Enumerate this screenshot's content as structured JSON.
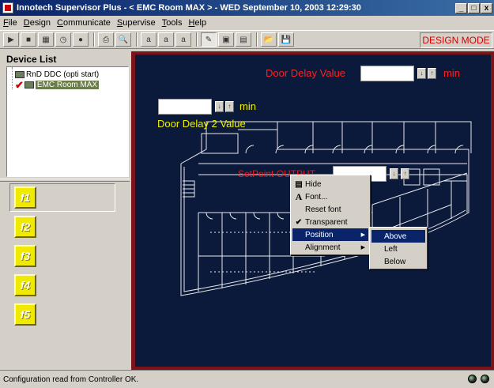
{
  "window": {
    "title": "Innotech Supervisor Plus - < EMC Room MAX > - WED September 10, 2003 12:29:30",
    "minimize_icon": "minimize-icon",
    "maximize_icon": "maximize-icon",
    "close_icon": "close-icon",
    "buttons": [
      "_",
      "□",
      "x"
    ]
  },
  "menu": [
    "File",
    "Design",
    "Communicate",
    "Supervise",
    "Tools",
    "Help"
  ],
  "toolbar": {
    "mode_label": "DESIGN MODE",
    "icons": [
      "play-icon",
      "stop-icon",
      "grid-icon",
      "clock-icon",
      "record-icon",
      "print-icon",
      "preview-icon",
      "text-1-icon",
      "text-2-icon",
      "text-3-icon",
      "design-icon",
      "image-icon",
      "paste-icon",
      "open-icon",
      "save-icon"
    ],
    "glyphs": [
      "▶",
      "■",
      "▦",
      "◷",
      "●",
      "⎙",
      "🔍",
      "a",
      "a",
      "a",
      "✎",
      "▣",
      "▤",
      "📂",
      "💾"
    ]
  },
  "device_list": {
    "title": "Device List",
    "items": [
      {
        "label": "RnD DDC (opti start)",
        "checked": false
      },
      {
        "label": "EMC Room MAX",
        "checked": true,
        "selected": true
      }
    ]
  },
  "function_keys": [
    "f1",
    "f2",
    "f3",
    "f4",
    "f5"
  ],
  "canvas": {
    "door_delay_label": "Door Delay Value",
    "door_delay_unit": "min",
    "door_delay_value": "",
    "door_delay2_label": "Door Delay 2 Value",
    "door_delay2_unit": "min",
    "door_delay2_value": "",
    "setpoint_label": "SetPoint OUTPUT",
    "setpoint_value": "",
    "spin_down": "↓",
    "spin_up": "↑"
  },
  "context_menu": {
    "items": [
      {
        "label": "Hide",
        "icon": "hide-icon",
        "glyph": "▤"
      },
      {
        "label": "Font...",
        "icon": "font-icon",
        "glyph": "A"
      },
      {
        "label": "Reset font",
        "icon": "",
        "glyph": ""
      },
      {
        "label": "Transparent",
        "icon": "checkmark-icon",
        "glyph": "✔",
        "checked": true
      },
      {
        "label": "Position",
        "icon": "",
        "glyph": "",
        "submenu": true,
        "highlighted": true
      },
      {
        "label": "Alignment",
        "icon": "",
        "glyph": "",
        "submenu": true
      }
    ],
    "submenu": [
      "Above",
      "Left",
      "Below"
    ],
    "submenu_highlighted": "Above"
  },
  "status": {
    "text": "Configuration read from Controller OK."
  }
}
